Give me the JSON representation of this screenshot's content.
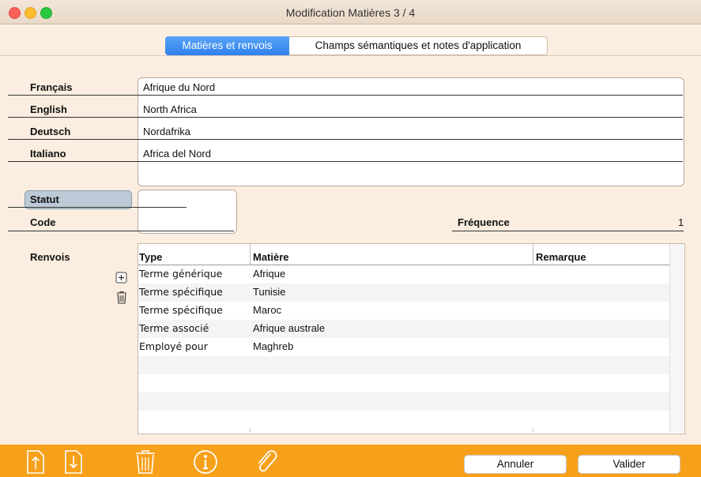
{
  "window": {
    "title": "Modification Matières   3 / 4"
  },
  "tabs": [
    {
      "label": "Matières et renvois",
      "active": true
    },
    {
      "label": "Champs sémantiques et notes d'application",
      "active": false
    }
  ],
  "languages": [
    {
      "label": "Français",
      "value": "Afrique du Nord"
    },
    {
      "label": "English",
      "value": "North Africa"
    },
    {
      "label": "Deutsch",
      "value": "Nordafrika"
    },
    {
      "label": "Italiano",
      "value": "Africa del Nord"
    }
  ],
  "fields": {
    "statut_label": "Statut",
    "code_label": "Code",
    "frequence_label": "Fréquence",
    "frequence_value": "1",
    "renvois_label": "Renvois"
  },
  "table": {
    "headers": [
      "Type",
      "Matière",
      "Remarque"
    ],
    "rows": [
      {
        "type": "Terme générique",
        "matiere": "Afrique",
        "remarque": ""
      },
      {
        "type": "Terme spécifique",
        "matiere": "Tunisie",
        "remarque": ""
      },
      {
        "type": "Terme spécifique",
        "matiere": "Maroc",
        "remarque": ""
      },
      {
        "type": "Terme associé",
        "matiere": "Afrique australe",
        "remarque": ""
      },
      {
        "type": "Employé pour",
        "matiere": "Maghreb",
        "remarque": ""
      }
    ]
  },
  "buttons": {
    "cancel": "Annuler",
    "validate": "Valider"
  },
  "colors": {
    "accent": "#f7a019",
    "tab_active": "#3a8cf0",
    "background": "#fbeee0"
  }
}
